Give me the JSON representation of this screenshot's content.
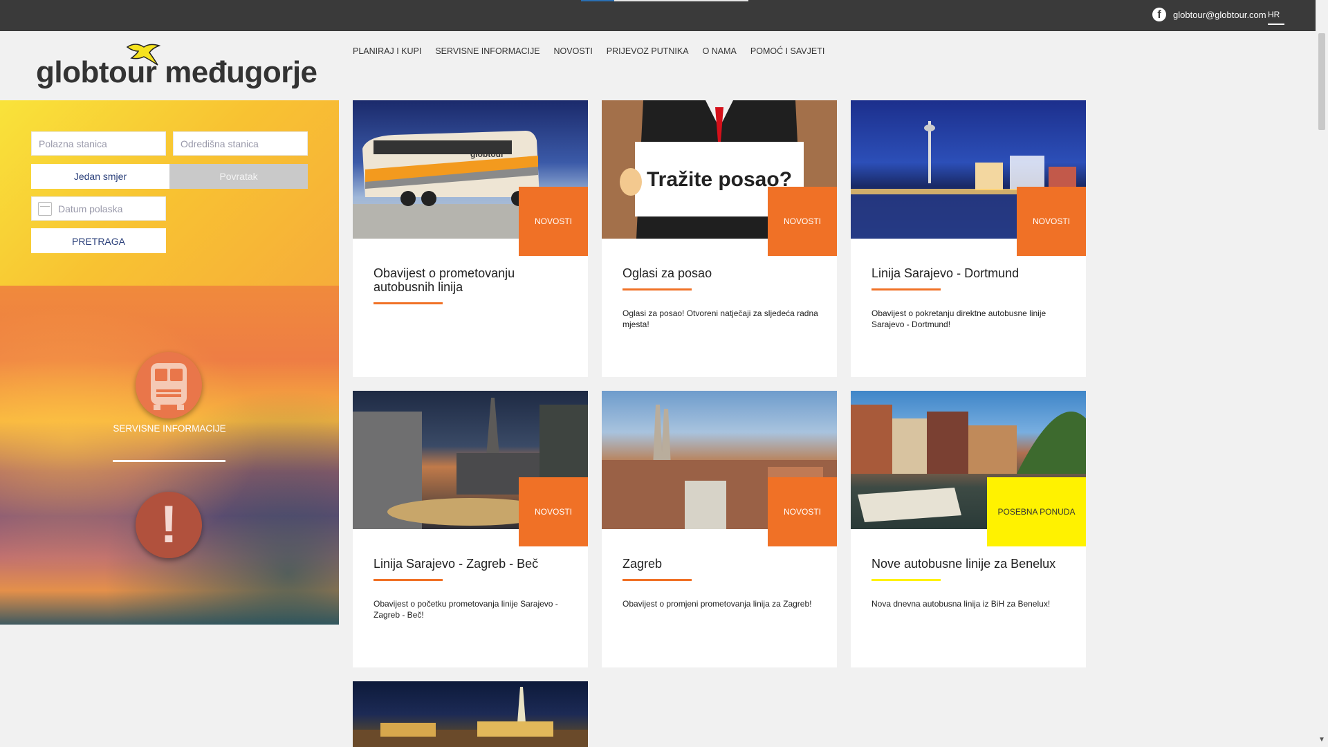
{
  "topbar": {
    "email": "globtour@globtour.com",
    "language": "HR",
    "social_icon": "facebook-icon"
  },
  "header": {
    "logo_text": "globtour međugorje",
    "nav": [
      "PLANIRAJ I KUPI",
      "SERVISNE INFORMACIJE",
      "NOVOSTI",
      "PRIJEVOZ PUTNIKA",
      "O NAMA",
      "POMOĆ I SAVJETI"
    ]
  },
  "search": {
    "departure_placeholder": "Polazna stanica",
    "destination_placeholder": "Odredišna stanica",
    "one_way": "Jedan smjer",
    "return": "Povratak",
    "date_placeholder": "Datum polaska",
    "search_button": "PRETRAGA"
  },
  "service": {
    "label": "SERVISNE INFORMACIJE",
    "bus_icon": "bus-icon",
    "alert_icon": "alert-icon"
  },
  "cards": [
    {
      "tag": "NOVOSTI",
      "title": "Obavijest o prometovanju autobusnih linija",
      "desc": ""
    },
    {
      "tag": "NOVOSTI",
      "title": "Oglasi za posao",
      "desc": "Oglasi za posao! Otvoreni natječaji za sljedeća radna mjesta!"
    },
    {
      "tag": "NOVOSTI",
      "title": "Linija Sarajevo - Dortmund",
      "desc": "Obavijest o pokretanju direktne autobusne linije Sarajevo - Dortmund!"
    },
    {
      "tag": "NOVOSTI",
      "title": "Linija Sarajevo - Zagreb - Beč",
      "desc": "Obavijest o početku prometovanja linije Sarajevo - Zagreb - Beč!"
    },
    {
      "tag": "NOVOSTI",
      "title": "Zagreb",
      "desc": "Obavijest o promjeni prometovanja linija za Zagreb!"
    },
    {
      "tag": "POSEBNA PONUDA",
      "title": "Nove autobusne linije za Benelux",
      "desc": "Nova dnevna autobusna linija iz BiH za Benelux!"
    }
  ],
  "job_sign_text": "Tražite posao?",
  "bus_livery_text": "globtour",
  "colors": {
    "accent_orange": "#f07126",
    "accent_yellow": "#fff200",
    "topbar": "#3a3a3a",
    "link_blue": "#2a3f7a"
  }
}
